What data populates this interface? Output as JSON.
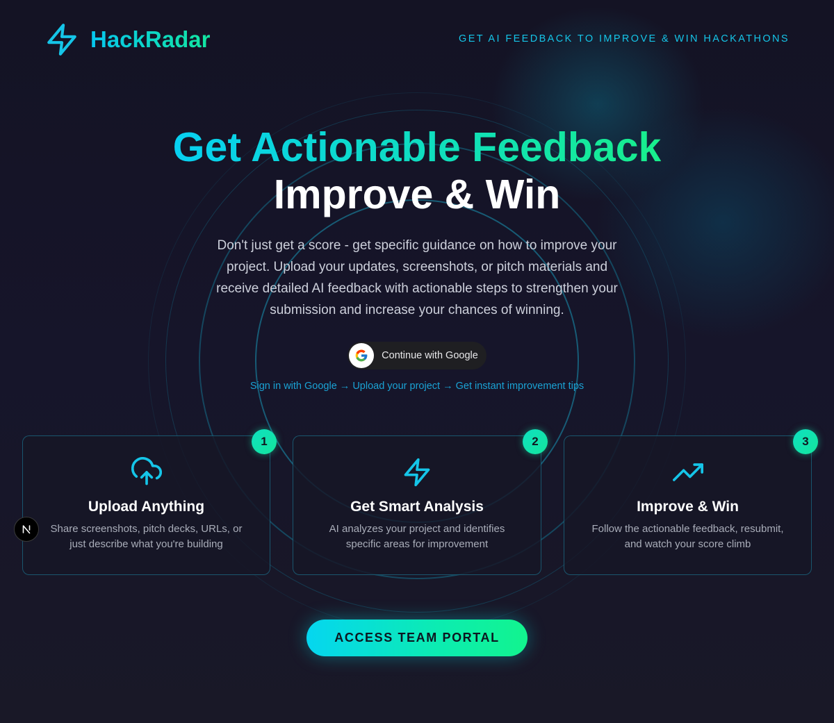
{
  "brand": {
    "name": "HackRadar",
    "logo_icon": "lightning-bolt-icon"
  },
  "header": {
    "tagline": "GET AI FEEDBACK TO IMPROVE & WIN HACKATHONS"
  },
  "hero": {
    "headline_line1": "Get Actionable Feedback",
    "headline_line2": "Improve & Win",
    "description": "Don't just get a score - get specific guidance on how to improve your project. Upload your updates, screenshots, or pitch materials and receive detailed AI feedback with actionable steps to strengthen your submission and increase your chances of winning.",
    "google_button": {
      "label": "Continue with Google",
      "icon": "google-icon"
    },
    "steps_hint": "Sign in with Google → Upload your project → Get instant improvement tips"
  },
  "features": [
    {
      "number": "1",
      "icon": "cloud-upload-icon",
      "title": "Upload Anything",
      "text": "Share screenshots, pitch decks, URLs, or just describe what you're building"
    },
    {
      "number": "2",
      "icon": "lightning-bolt-icon",
      "title": "Get Smart Analysis",
      "text": "AI analyzes your project and identifies specific areas for improvement"
    },
    {
      "number": "3",
      "icon": "trending-up-icon",
      "title": "Improve & Win",
      "text": "Follow the actionable feedback, resubmit, and watch your score climb"
    }
  ],
  "cta": {
    "label": "ACCESS TEAM PORTAL"
  },
  "floating_badge": {
    "icon": "nextjs-icon"
  },
  "colors": {
    "background": "#14131f",
    "accent_cyan": "#06c6ee",
    "accent_green": "#13e6a0",
    "card_border": "#1e8caa",
    "steps_link": "#1aa2d4"
  }
}
